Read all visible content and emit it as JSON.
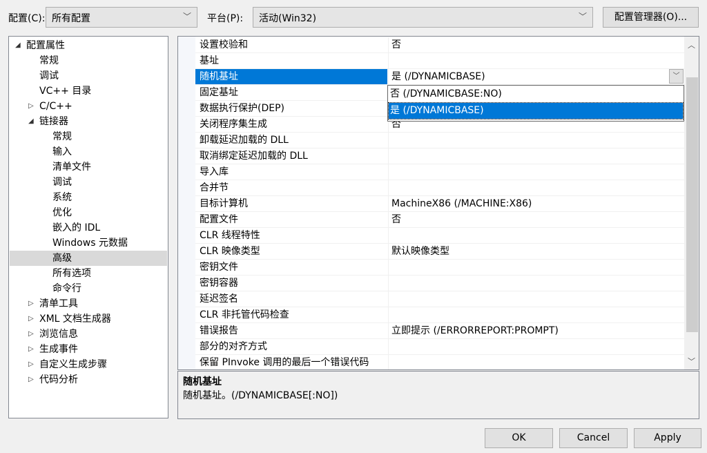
{
  "toolbar": {
    "config_label": "配置(C):",
    "config_value": "所有配置",
    "platform_label": "平台(P):",
    "platform_value": "活动(Win32)",
    "config_manager": "配置管理器(O)..."
  },
  "tree": [
    {
      "label": "配置属性",
      "level": 0,
      "arrow": "expanded"
    },
    {
      "label": "常规",
      "level": 1
    },
    {
      "label": "调试",
      "level": 1
    },
    {
      "label": "VC++ 目录",
      "level": 1
    },
    {
      "label": "C/C++",
      "level": 1,
      "arrow": "collapsed"
    },
    {
      "label": "链接器",
      "level": 1,
      "arrow": "expanded"
    },
    {
      "label": "常规",
      "level": 2
    },
    {
      "label": "输入",
      "level": 2
    },
    {
      "label": "清单文件",
      "level": 2
    },
    {
      "label": "调试",
      "level": 2
    },
    {
      "label": "系统",
      "level": 2
    },
    {
      "label": "优化",
      "level": 2
    },
    {
      "label": "嵌入的 IDL",
      "level": 2
    },
    {
      "label": "Windows 元数据",
      "level": 2
    },
    {
      "label": "高级",
      "level": 2,
      "selected": true
    },
    {
      "label": "所有选项",
      "level": 2
    },
    {
      "label": "命令行",
      "level": 2
    },
    {
      "label": "清单工具",
      "level": 1,
      "arrow": "collapsed"
    },
    {
      "label": "XML 文档生成器",
      "level": 1,
      "arrow": "collapsed"
    },
    {
      "label": "浏览信息",
      "level": 1,
      "arrow": "collapsed"
    },
    {
      "label": "生成事件",
      "level": 1,
      "arrow": "collapsed"
    },
    {
      "label": "自定义生成步骤",
      "level": 1,
      "arrow": "collapsed"
    },
    {
      "label": "代码分析",
      "level": 1,
      "arrow": "collapsed"
    }
  ],
  "grid": [
    {
      "name": "设置校验和",
      "value": "否"
    },
    {
      "name": "基址",
      "value": ""
    },
    {
      "name": "随机基址",
      "value": "是 (/DYNAMICBASE)",
      "selected": true
    },
    {
      "name": "固定基址",
      "value": ""
    },
    {
      "name": "数据执行保护(DEP)",
      "value": ""
    },
    {
      "name": "关闭程序集生成",
      "value": "否"
    },
    {
      "name": "卸载延迟加载的 DLL",
      "value": ""
    },
    {
      "name": "取消绑定延迟加载的 DLL",
      "value": ""
    },
    {
      "name": "导入库",
      "value": ""
    },
    {
      "name": "合并节",
      "value": ""
    },
    {
      "name": "目标计算机",
      "value": "MachineX86 (/MACHINE:X86)"
    },
    {
      "name": "配置文件",
      "value": "否"
    },
    {
      "name": "CLR 线程特性",
      "value": ""
    },
    {
      "name": "CLR 映像类型",
      "value": "默认映像类型"
    },
    {
      "name": "密钥文件",
      "value": ""
    },
    {
      "name": "密钥容器",
      "value": ""
    },
    {
      "name": "延迟签名",
      "value": ""
    },
    {
      "name": "CLR 非托管代码检查",
      "value": ""
    },
    {
      "name": "错误报告",
      "value": "立即提示 (/ERRORREPORT:PROMPT)"
    },
    {
      "name": "部分的对齐方式",
      "value": ""
    },
    {
      "name": "保留 PInvoke 调用的最后一个错误代码",
      "value": ""
    }
  ],
  "dropdown": {
    "options": [
      "否 (/DYNAMICBASE:NO)",
      "是 (/DYNAMICBASE)"
    ],
    "selected": 1
  },
  "description": {
    "title": "随机基址",
    "text": "随机基址。(/DYNAMICBASE[:NO])"
  },
  "buttons": {
    "ok": "OK",
    "cancel": "Cancel",
    "apply": "Apply"
  },
  "colors": {
    "selection": "#0078d7"
  }
}
